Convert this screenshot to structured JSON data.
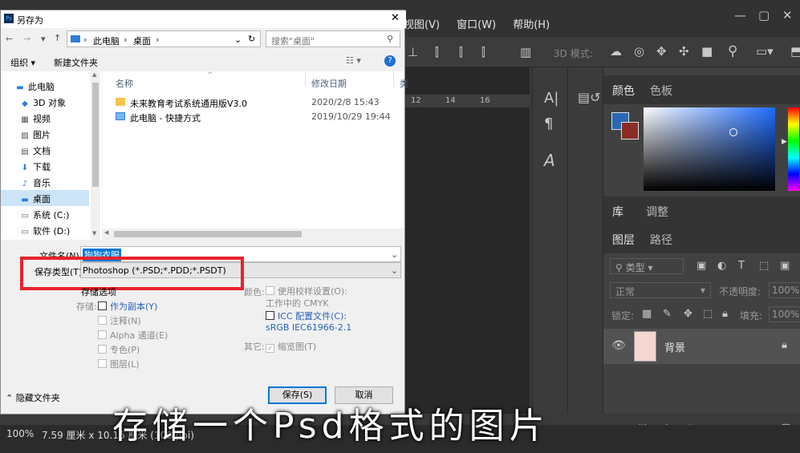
{
  "ps": {
    "menu": [
      "视图(V)",
      "窗口(W)",
      "帮助(H)"
    ],
    "mode3d": "3D 模式:",
    "ruler_ticks": [
      "12",
      "14",
      "16"
    ],
    "panel_color_tabs": [
      "颜色",
      "色板"
    ],
    "panel_lib_tabs": [
      "库",
      "调整"
    ],
    "panel_layer_tabs": [
      "图层",
      "路径"
    ],
    "layer_filter": "类型",
    "blend_mode": "正常",
    "opacity_label": "不透明度:",
    "opacity_value": "100%",
    "lock_label": "锁定:",
    "fill_label": "填充:",
    "fill_value": "100%",
    "layer_name": "背景",
    "status_zoom": "100%",
    "status_doc": "7.59 厘米 x 10.16 厘米 (100 ppi)",
    "colors": {
      "fg": "#2a68b4",
      "bg": "#8a2e24",
      "accent": "#e8232b"
    }
  },
  "dialog": {
    "title": "另存为",
    "breadcrumb": [
      "此电脑",
      "桌面"
    ],
    "search_placeholder": "搜索\"桌面\"",
    "organize": "组织",
    "new_folder": "新建文件夹",
    "col_name": "名称",
    "col_date": "修改日期",
    "col_type": "类",
    "files": [
      {
        "name": "未来教育考试系统通用版V3.0",
        "date": "2020/2/8 15:43",
        "icon": "folder-icon"
      },
      {
        "name": "此电脑 - 快捷方式",
        "date": "2019/10/29 19:44",
        "icon": "shortcut-icon"
      }
    ],
    "nav": [
      {
        "label": "此电脑",
        "icon": "pc-icon"
      },
      {
        "label": "3D 对象",
        "icon": "cube-icon"
      },
      {
        "label": "视频",
        "icon": "video-icon"
      },
      {
        "label": "图片",
        "icon": "image-icon"
      },
      {
        "label": "文档",
        "icon": "document-icon"
      },
      {
        "label": "下载",
        "icon": "download-icon"
      },
      {
        "label": "音乐",
        "icon": "music-icon"
      },
      {
        "label": "桌面",
        "icon": "desktop-icon"
      },
      {
        "label": "系统 (C:)",
        "icon": "drive-icon"
      },
      {
        "label": "软件 (D:)",
        "icon": "drive-icon"
      }
    ],
    "filename_label": "文件名(N):",
    "filename_value": "狗狗衣服",
    "savetype_label": "保存类型(T):",
    "savetype_value": "Photoshop (*.PSD;*.PDD;*.PSDT)",
    "save_options": "存储选项",
    "store_label": "存储:",
    "as_copy": "作为副本(Y)",
    "notes": "注释(N)",
    "alpha": "Alpha 通道(E)",
    "spot": "专色(P)",
    "layers": "图层(L)",
    "color_label": "颜色:",
    "proof": "使用校样设置(O): 工作中的 CMYK",
    "icc": "ICC 配置文件(C): sRGB IEC61966-2.1",
    "other_label": "其它:",
    "thumbnail": "缩览图(T)",
    "hide_folders": "隐藏文件夹",
    "save_btn": "保存(S)",
    "cancel_btn": "取消"
  },
  "overlay_caption": "存储一个Psd格式的图片"
}
